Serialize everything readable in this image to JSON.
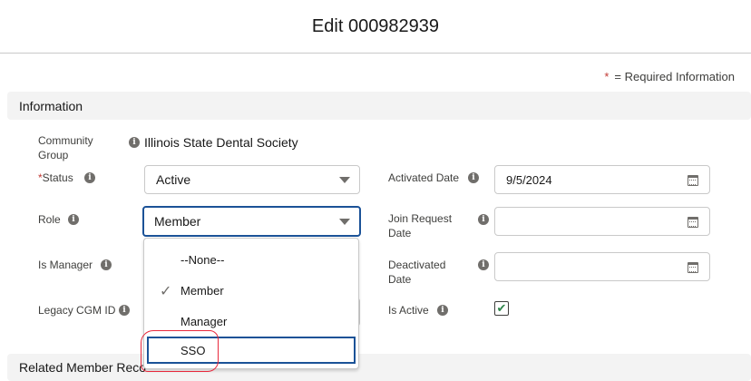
{
  "header": {
    "title": "Edit 000982939"
  },
  "required_note": {
    "star": "*",
    "text": "= Required Information"
  },
  "sections": {
    "information": "Information",
    "related": "Related Member Reco"
  },
  "fields": {
    "community_group": {
      "label_line1": "Community",
      "label_line2": "Group",
      "value": "Illinois State Dental Society"
    },
    "status": {
      "star": "*",
      "label": "Status",
      "value": "Active"
    },
    "role": {
      "label": "Role",
      "value": "Member"
    },
    "is_manager": {
      "label": "Is Manager"
    },
    "legacy_cgm_id": {
      "label": "Legacy CGM ID"
    },
    "activated_date": {
      "label": "Activated Date",
      "value": "9/5/2024"
    },
    "join_request_date": {
      "label_line1": "Join Request",
      "label_line2": "Date",
      "value": ""
    },
    "deactivated_date": {
      "label_line1": "Deactivated",
      "label_line2": "Date",
      "value": ""
    },
    "is_active": {
      "label": "Is Active",
      "checked": true,
      "check_glyph": "✔"
    }
  },
  "role_dropdown": {
    "options": [
      "--None--",
      "Member",
      "Manager",
      "SSO"
    ],
    "selected": "Member",
    "highlighted": "SSO",
    "check_glyph": "✓"
  },
  "icons": {
    "info": "i",
    "calendar": "calendar-icon",
    "caret": "chevron-down-icon"
  },
  "colors": {
    "focus_border": "#1b5297",
    "required_star": "#c23934",
    "checkbox_check": "#2e844a",
    "annotation": "#e8283c",
    "section_bg": "#f3f3f3"
  }
}
